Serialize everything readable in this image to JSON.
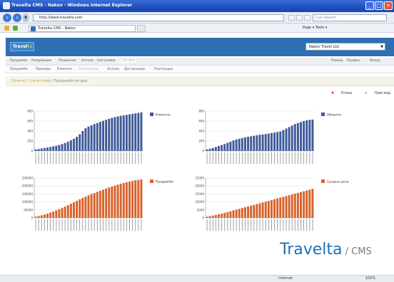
{
  "window": {
    "title": "Travelta CMS - Nakov - Windows Internet Explorer",
    "controls": [
      "_",
      "□",
      "×"
    ]
  },
  "address": {
    "url": "http://www.travelta.com",
    "search_placeholder": "Live Search"
  },
  "tabs": [
    {
      "label": "Travelta CMS - Nakov"
    }
  ],
  "browser_toolbar": {
    "right_text": "Page ▾  Tools ▾"
  },
  "app": {
    "logo": {
      "text": "Travel",
      "accent": "ta"
    },
    "company_select": "Nakov Travel Ltd."
  },
  "main_nav": [
    {
      "label": "Продажба",
      "active": false
    },
    {
      "label": "Резервации",
      "active": false
    },
    {
      "label": "Плащания",
      "active": false
    },
    {
      "label": "Хотели",
      "active": false
    },
    {
      "label": "Настройки",
      "active": false
    },
    {
      "label": "Отчети",
      "active": true
    }
  ],
  "main_nav_right": [
    {
      "label": "Помощ"
    },
    {
      "label": "Профил"
    },
    {
      "label": "Изход"
    }
  ],
  "sub_nav": [
    {
      "label": "Продажби",
      "active": false
    },
    {
      "label": "Приходи",
      "active": false
    },
    {
      "label": "Клиенти",
      "active": false
    },
    {
      "label": "Статистики",
      "active": true
    },
    {
      "label": "Хотели",
      "active": false
    },
    {
      "label": "Дестинации",
      "active": false
    },
    {
      "label": "Партньори",
      "active": false
    }
  ],
  "breadcrumb": {
    "link": "Отчети / Статистики",
    "current": " / Продажби по дни"
  },
  "actions": {
    "cancel": "Отказ",
    "confirm": "Преглед"
  },
  "charts": [
    {
      "legend": "Клиенти",
      "color": "#3f5a99",
      "ymax": 800,
      "yticks": [
        "800",
        "600",
        "400",
        "200",
        "0"
      ],
      "values": [
        30,
        40,
        50,
        60,
        70,
        80,
        95,
        105,
        120,
        140,
        160,
        185,
        215,
        245,
        285,
        335,
        400,
        455,
        490,
        515,
        540,
        560,
        585,
        605,
        625,
        645,
        665,
        680,
        695,
        705,
        715,
        725,
        735,
        745,
        755,
        765,
        775
      ]
    },
    {
      "legend": "Обороти",
      "color": "#3f5a99",
      "ymax": 800,
      "yticks": [
        "800",
        "600",
        "400",
        "200",
        "0"
      ],
      "values": [
        30,
        45,
        60,
        80,
        100,
        120,
        140,
        165,
        185,
        210,
        230,
        245,
        260,
        275,
        285,
        295,
        305,
        315,
        325,
        330,
        340,
        350,
        360,
        370,
        380,
        390,
        420,
        450,
        480,
        510,
        540,
        560,
        580,
        600,
        615,
        625,
        630
      ]
    },
    {
      "legend": "Продажби",
      "color": "#d9622b",
      "ymax": 250000,
      "yticks": [
        "250000",
        "200000",
        "150000",
        "100000",
        "50000",
        "0"
      ],
      "values": [
        8000,
        12000,
        16000,
        21000,
        27000,
        33000,
        40000,
        47000,
        55000,
        63000,
        71000,
        80000,
        89000,
        98000,
        107000,
        116000,
        125000,
        133000,
        141000,
        149000,
        156000,
        163000,
        170000,
        177000,
        184000,
        191000,
        197000,
        203000,
        209000,
        214000,
        219000,
        224000,
        228000,
        232000,
        236000,
        239000,
        242000
      ]
    },
    {
      "legend": "Средна цена",
      "color": "#d9622b",
      "ymax": 25000,
      "yticks": [
        "25000",
        "20000",
        "15000",
        "10000",
        "5000",
        "0"
      ],
      "values": [
        700,
        1100,
        1500,
        1900,
        2300,
        2700,
        3200,
        3700,
        4200,
        4700,
        5200,
        5700,
        6200,
        6700,
        7200,
        7700,
        8200,
        8700,
        9200,
        9700,
        10200,
        10700,
        11200,
        11700,
        12200,
        12700,
        13200,
        13700,
        14200,
        14700,
        15200,
        15700,
        16200,
        16700,
        17200,
        17700,
        18200
      ]
    }
  ],
  "brand": {
    "main": "Travelta",
    "suffix": " / CMS"
  },
  "statusbar": {
    "zone": "Internet",
    "zoom": "100%"
  }
}
